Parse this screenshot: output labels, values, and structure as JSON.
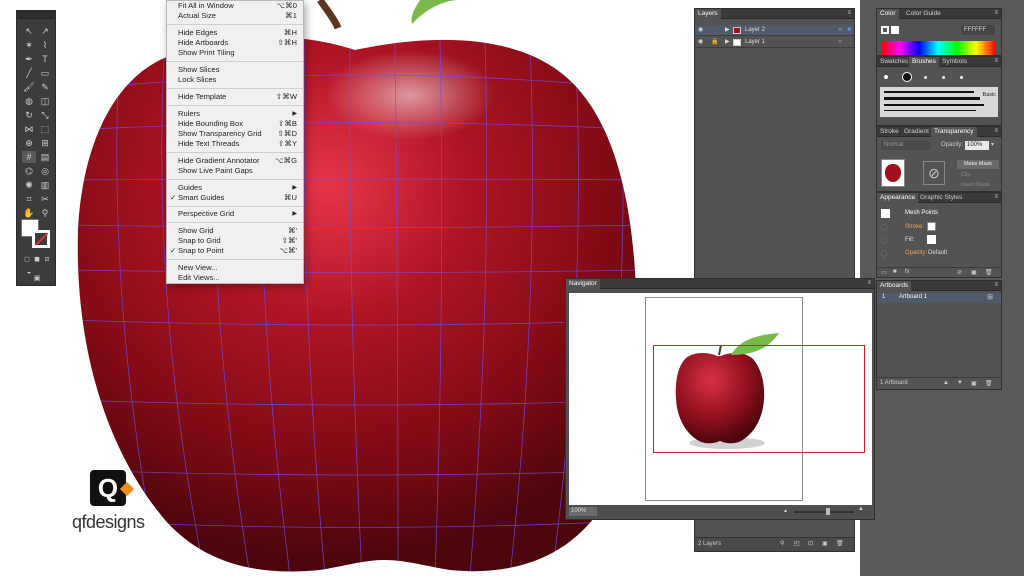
{
  "view_menu": {
    "items": [
      {
        "label": "Fit All in Window",
        "shortcut": "⌥⌘0"
      },
      {
        "label": "Actual Size",
        "shortcut": "⌘1"
      },
      {
        "label": "Hide Edges",
        "shortcut": "⌘H"
      },
      {
        "label": "Hide Artboards",
        "shortcut": "⇧⌘H"
      },
      {
        "label": "Show Print Tiling",
        "shortcut": ""
      },
      {
        "label": "Show Slices",
        "shortcut": ""
      },
      {
        "label": "Lock Slices",
        "shortcut": ""
      },
      {
        "label": "Hide Template",
        "shortcut": "⇧⌘W"
      },
      {
        "label": "Rulers",
        "shortcut": ""
      },
      {
        "label": "Hide Bounding Box",
        "shortcut": "⇧⌘B"
      },
      {
        "label": "Show Transparency Grid",
        "shortcut": "⇧⌘D"
      },
      {
        "label": "Hide Text Threads",
        "shortcut": "⇧⌘Y"
      },
      {
        "label": "Hide Gradient Annotator",
        "shortcut": "⌥⌘G"
      },
      {
        "label": "Show Live Paint Gaps",
        "shortcut": ""
      },
      {
        "label": "Guides",
        "shortcut": ""
      },
      {
        "label": "Smart Guides",
        "shortcut": "⌘U"
      },
      {
        "label": "Perspective Grid",
        "shortcut": ""
      },
      {
        "label": "Show Grid",
        "shortcut": "⌘'"
      },
      {
        "label": "Snap to Grid",
        "shortcut": "⇧⌘'"
      },
      {
        "label": "Snap to Point",
        "shortcut": "⌥⌘'"
      },
      {
        "label": "New View...",
        "shortcut": ""
      },
      {
        "label": "Edit Views...",
        "shortcut": ""
      }
    ]
  },
  "layers_panel": {
    "title": "Layers",
    "layers": [
      "Layer 2",
      "Layer 1"
    ],
    "footer": "2 Layers"
  },
  "color_panel": {
    "tabs": [
      "Color",
      "Color Guide"
    ],
    "hex": "FFFFFF"
  },
  "swatches_panel": {
    "tabs": [
      "Swatches",
      "Brushes",
      "Symbols"
    ],
    "brush_name": "Basic"
  },
  "transparency_panel": {
    "tabs": [
      "Stroke",
      "Gradient",
      "Transparency"
    ],
    "blend_mode": "Normal",
    "opacity_label": "Opacity:",
    "opacity_value": "100%",
    "make_mask": "Make Mask",
    "clip": "Clip",
    "invert_mask": "Invert Mask"
  },
  "appearance_panel": {
    "tabs": [
      "Appearance",
      "Graphic Styles"
    ],
    "object": "Mesh Points",
    "stroke_label": "Stroke:",
    "fill_label": "Fill:",
    "opacity_label": "Opacity:",
    "opacity_value": "Default"
  },
  "artboards_panel": {
    "title": "Artboards",
    "rows": [
      {
        "index": "1",
        "name": "Artboard 1"
      }
    ],
    "footer": "1 Artboard"
  },
  "navigator_panel": {
    "title": "Navigator",
    "zoom": "100%"
  },
  "logo": {
    "brand_text": "qfdesigns",
    "mark": "Q"
  },
  "colors": {
    "apple_red": "#a0101e",
    "mesh_line": "#6f4fe8",
    "proxy_box": "#d0202a",
    "panel_bg": "#535353"
  }
}
